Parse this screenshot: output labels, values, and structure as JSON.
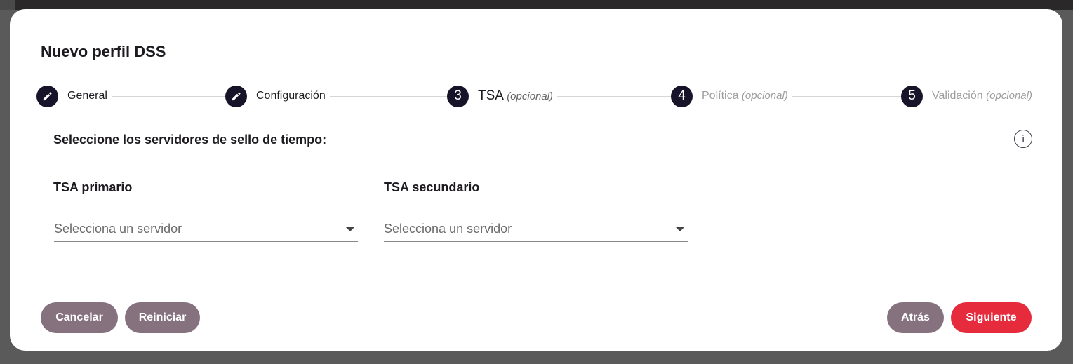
{
  "dialog": {
    "title": "Nuevo perfil DSS",
    "steps": [
      {
        "icon": "pencil-icon",
        "number": "",
        "label": "General",
        "optional": "",
        "state": "done"
      },
      {
        "icon": "pencil-icon",
        "number": "",
        "label": "Configuración",
        "optional": "",
        "state": "done"
      },
      {
        "icon": "",
        "number": "3",
        "label": "TSA",
        "optional": "(opcional)",
        "state": "active"
      },
      {
        "icon": "",
        "number": "4",
        "label": "Política",
        "optional": "(opcional)",
        "state": "inactive"
      },
      {
        "icon": "",
        "number": "5",
        "label": "Validación",
        "optional": "(opcional)",
        "state": "inactive"
      }
    ],
    "section_title": "Seleccione los servidores de sello de tiempo:",
    "info_icon": "i",
    "primary": {
      "label": "TSA primario",
      "placeholder": "Selecciona un servidor"
    },
    "secondary": {
      "label": "TSA secundario",
      "placeholder": "Selecciona un servidor"
    },
    "buttons": {
      "cancel": "Cancelar",
      "reset": "Reiniciar",
      "back": "Atrás",
      "next": "Siguiente"
    }
  },
  "colors": {
    "step_circle": "#17142a",
    "muted_button": "#86727f",
    "primary_button": "#e52b3c"
  }
}
